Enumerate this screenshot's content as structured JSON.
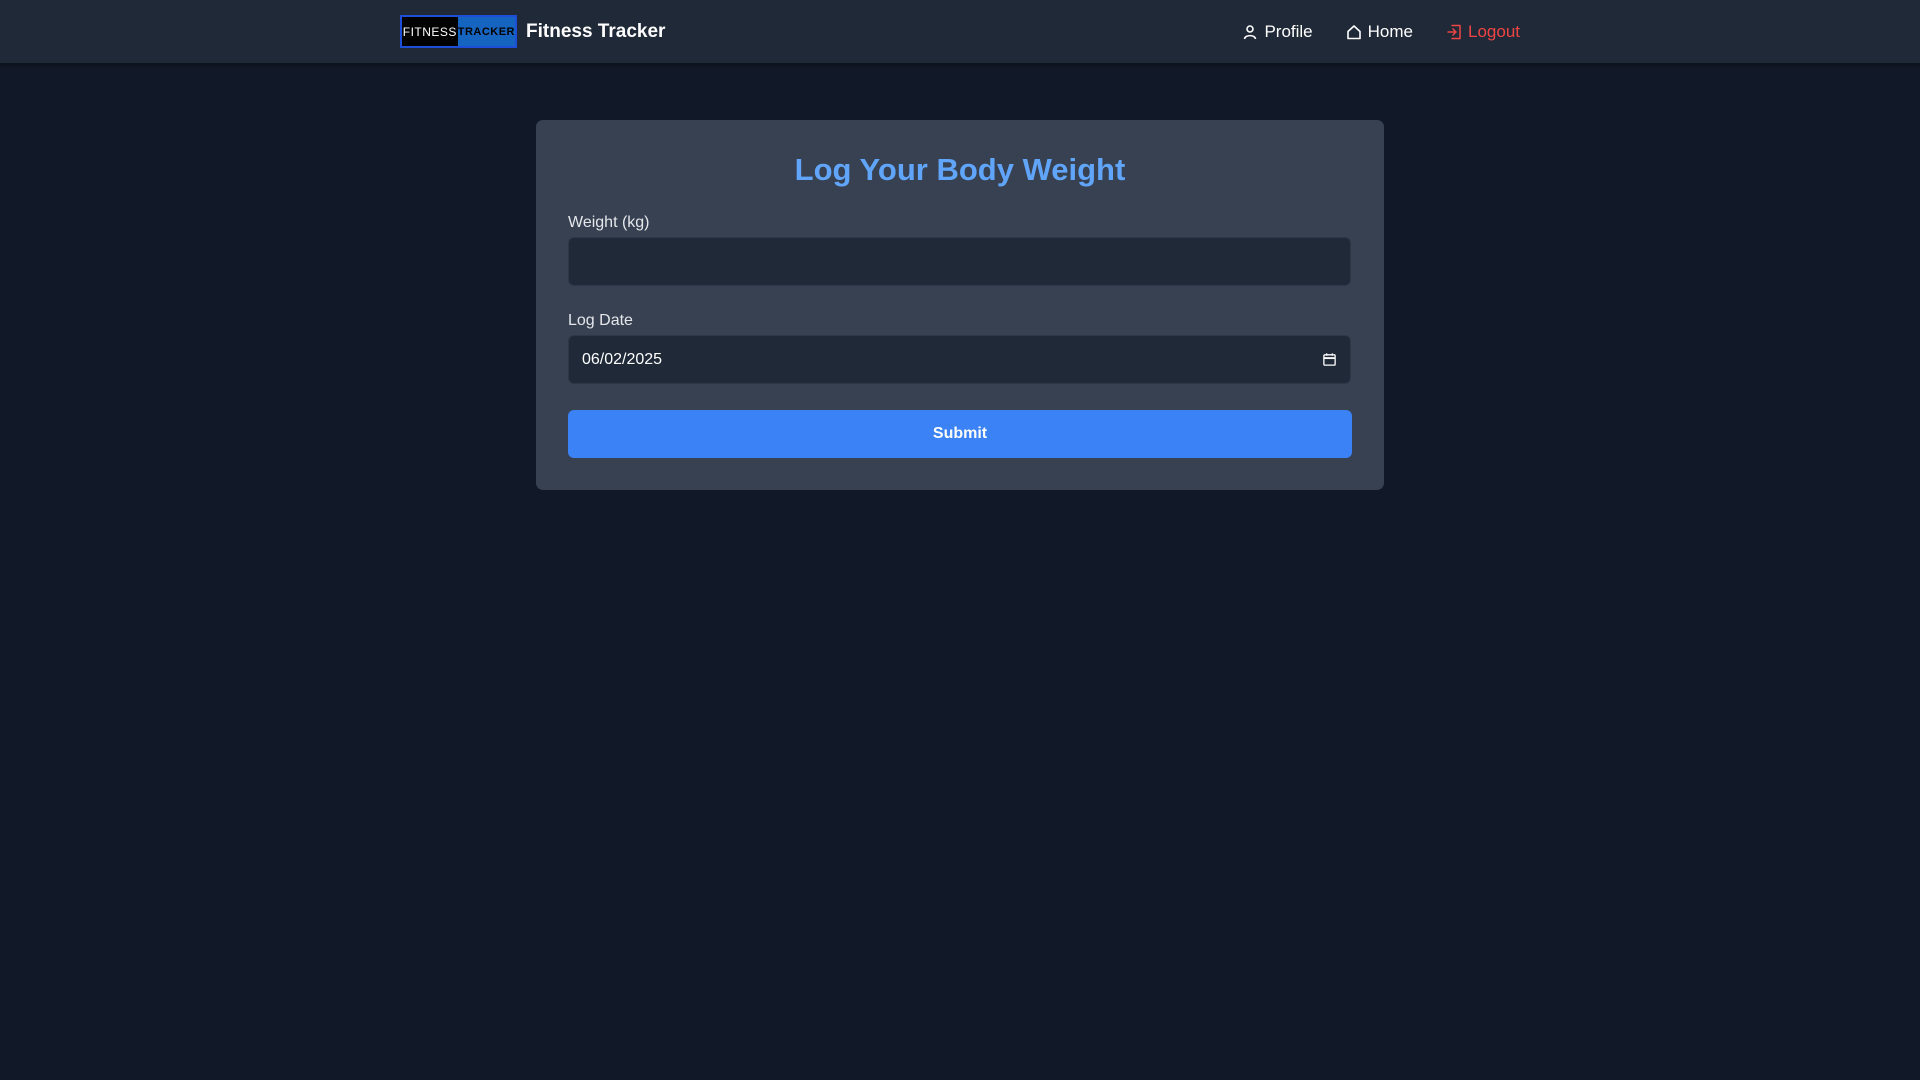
{
  "header": {
    "logo_left": "FITNESS",
    "logo_right": "TRACKER",
    "brand_title": "Fitness Tracker",
    "nav": {
      "profile": "Profile",
      "home": "Home",
      "logout": "Logout"
    },
    "icons": {
      "profile": "user-icon",
      "home": "home-icon",
      "logout": "logout-icon"
    }
  },
  "form": {
    "title": "Log Your Body Weight",
    "weight_label": "Weight (kg)",
    "weight_value": "",
    "date_label": "Log Date",
    "date_value": "06/02/2025",
    "date_icon": "calendar-icon",
    "submit_label": "Submit"
  },
  "colors": {
    "page_bg": "#111827",
    "navbar_bg": "#1f2937",
    "card_bg": "#374151",
    "title": "#60a5fa",
    "submit": "#3b82f6",
    "logout": "#ef4444"
  }
}
